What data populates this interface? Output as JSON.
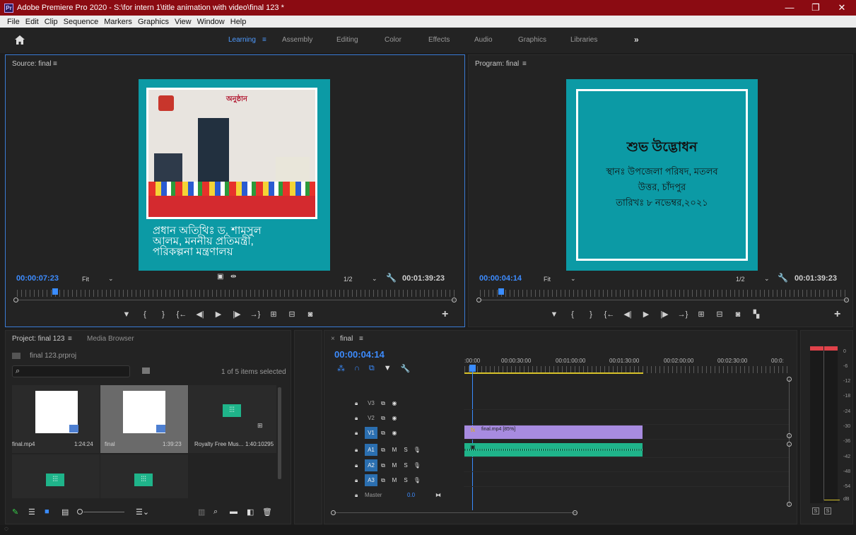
{
  "titlebar": {
    "app_icon": "Pr",
    "title": "Adobe Premiere Pro 2020 - S:\\for intern 1\\title animation with video\\final 123 *",
    "minimize": "—",
    "restore": "❐",
    "close": "✕"
  },
  "menu": [
    "File",
    "Edit",
    "Clip",
    "Sequence",
    "Markers",
    "Graphics",
    "View",
    "Window",
    "Help"
  ],
  "workspaces": {
    "home": "home-icon",
    "tabs": [
      "Learning",
      "Assembly",
      "Editing",
      "Color",
      "Effects",
      "Audio",
      "Graphics",
      "Libraries"
    ],
    "active": "Learning",
    "more": "»",
    "menu_glyph": "≡"
  },
  "source": {
    "title": "Source: final",
    "menu_glyph": "≡",
    "overlay_text": [
      "প্রধান অতিথিঃ ড. শামসুল",
      "আলম, মননীয় প্রতিমন্ত্রী,",
      "পরিকল্পনা মন্ত্রণালয়"
    ],
    "banner_text": "অনুষ্ঠান",
    "timecode": "00:00:07:23",
    "zoom": "Fit",
    "resolution": "1/2",
    "duration": "00:01:39:23",
    "playhead_fraction": 0.08
  },
  "program": {
    "title": "Program: final",
    "menu_glyph": "≡",
    "headline": "শুভ উদ্ভোধন",
    "lines": [
      "স্থানঃ উপজেলা পরিষদ, মতলব",
      "উত্তর, চাঁদপুর",
      "তারিখঃ ৮ নভেম্বর,২০২১"
    ],
    "timecode": "00:00:04:14",
    "zoom": "Fit",
    "resolution": "1/2",
    "duration": "00:01:39:23",
    "playhead_fraction": 0.05
  },
  "transport": {
    "marker": "▼",
    "in": "{",
    "out": "}",
    "goto_in": "{←",
    "step_back": "◀|",
    "play": "▶",
    "step_fwd": "|▶",
    "goto_out": "→}",
    "insert": "⊞",
    "overwrite": "⊟",
    "export_frame": "◙",
    "add": "+"
  },
  "project": {
    "title": "Project: final 123",
    "menu_glyph": "≡",
    "tab2": "Media Browser",
    "file": "final 123.prproj",
    "search_placeholder": "",
    "selection": "1 of 5 items selected",
    "items": [
      {
        "name": "final.mp4",
        "duration": "1:24:24"
      },
      {
        "name": "final",
        "duration": "1:39:23"
      },
      {
        "name": "Royalty Free Mus...",
        "duration": "1:40:10295"
      },
      {
        "name": "",
        "duration": ""
      },
      {
        "name": "",
        "duration": ""
      }
    ]
  },
  "timeline": {
    "close": "×",
    "title": "final",
    "menu_glyph": "≡",
    "timecode": "00:00:04:14",
    "ruler": [
      ":00:00",
      "00:00:30:00",
      "00:01:00:00",
      "00:01:30:00",
      "00:02:00:00",
      "00:02:30:00",
      "00:0:"
    ],
    "video_tracks": [
      "V3",
      "V2",
      "V1"
    ],
    "audio_tracks": [
      "A1",
      "A2",
      "A3"
    ],
    "master": "Master",
    "master_value": "0.0",
    "clip_video": "final.mp4 [85%]",
    "colors": {
      "video_clip": "#a78be0",
      "audio_clip": "#1fb48a",
      "timecode": "#3d8cff",
      "title_bar": "#8b0b12"
    }
  },
  "meters": {
    "labels": [
      "0",
      "-6",
      "-12",
      "-18",
      "-24",
      "-30",
      "-36",
      "-42",
      "-48",
      "-54",
      "dB"
    ],
    "solo": [
      "S",
      "S"
    ]
  }
}
